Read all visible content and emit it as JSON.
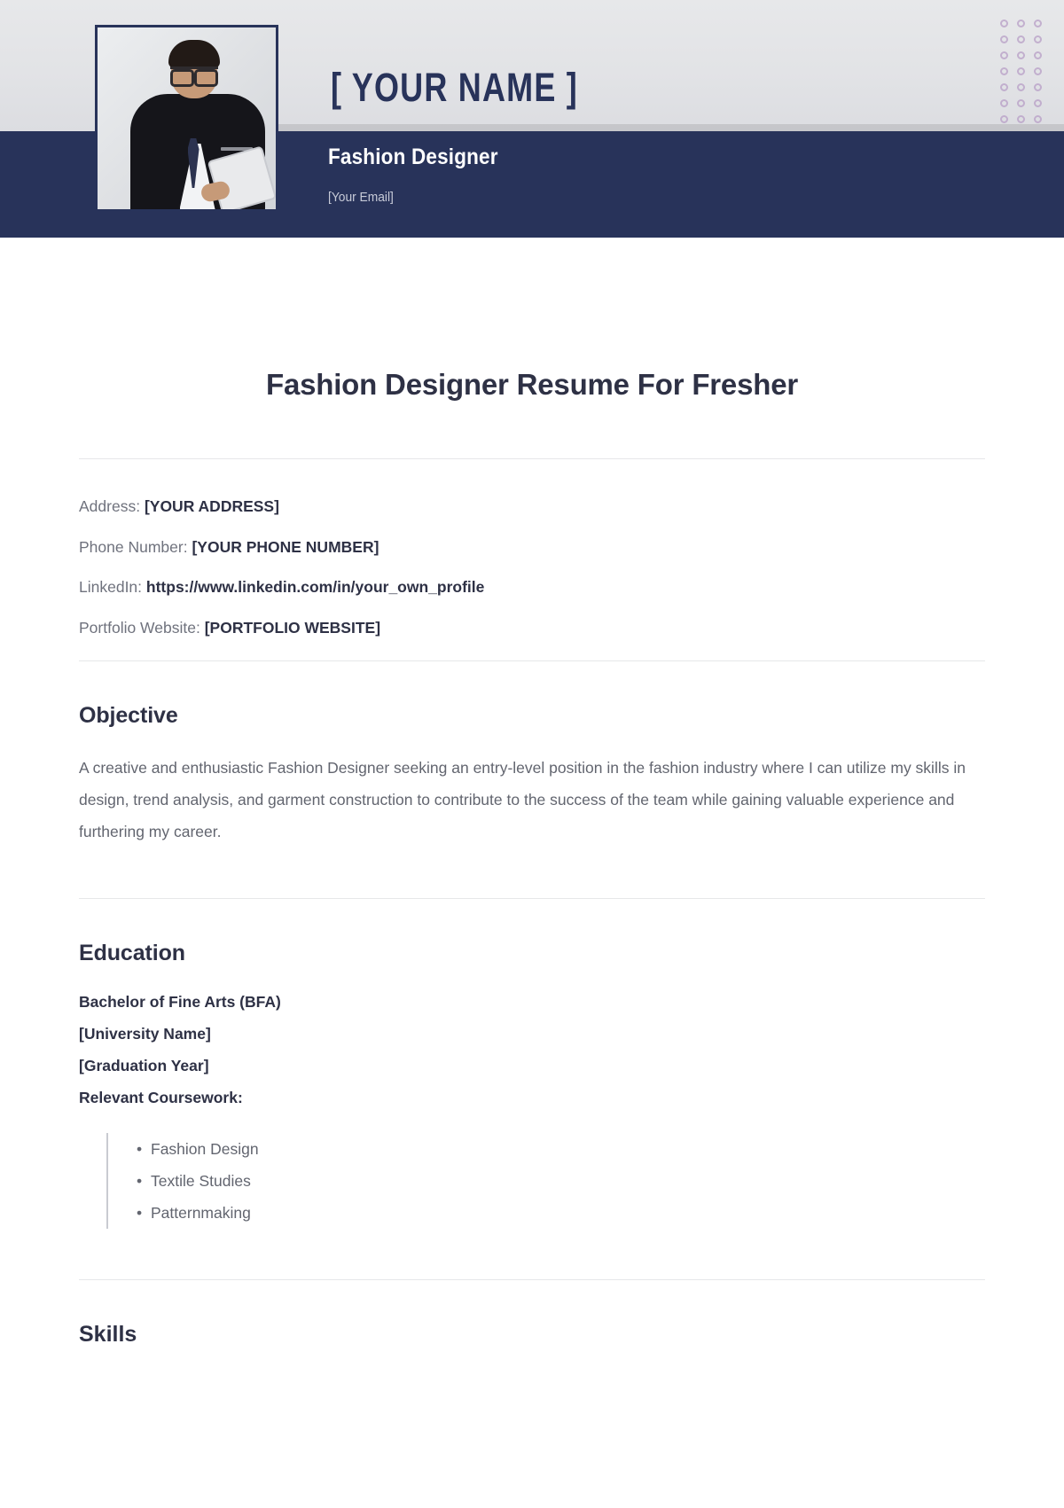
{
  "header": {
    "name": "[ YOUR NAME ]",
    "role": "Fashion Designer",
    "email": "[Your Email]",
    "photo_alt": "profile-photo",
    "decoration": {
      "name": "dot-grid",
      "columns": 3,
      "rows": 7,
      "color": "#b79ec6"
    },
    "colors": {
      "band": "#28335a",
      "top": "#e2e3e6"
    }
  },
  "document": {
    "title": "Fashion Designer Resume For Fresher",
    "accent_color": "#2e3145",
    "muted_color": "#62656f"
  },
  "contact": {
    "items": [
      {
        "label": "Address:",
        "value": "[YOUR ADDRESS]"
      },
      {
        "label": "Phone Number:",
        "value": "[YOUR PHONE NUMBER]"
      },
      {
        "label": "LinkedIn:",
        "value": "https://www.linkedin.com/in/your_own_profile"
      },
      {
        "label": "Portfolio Website:",
        "value": "[PORTFOLIO WEBSITE]"
      }
    ]
  },
  "objective": {
    "heading": "Objective",
    "text": "A creative and enthusiastic Fashion Designer seeking an entry-level position in the fashion industry where I can utilize my skills in design, trend analysis, and garment construction to contribute to the success of the team while gaining valuable experience and furthering my career."
  },
  "education": {
    "heading": "Education",
    "degree": "Bachelor of Fine Arts (BFA)",
    "university": "[University Name]",
    "graduation_year": "[Graduation Year]",
    "coursework_label": "Relevant Coursework:",
    "coursework": [
      "Fashion Design",
      "Textile Studies",
      "Patternmaking"
    ]
  },
  "skills": {
    "heading": "Skills"
  }
}
